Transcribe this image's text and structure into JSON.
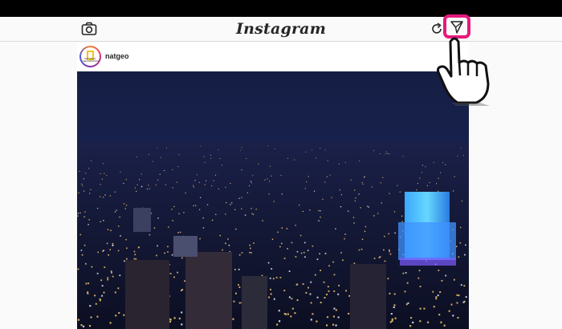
{
  "header": {
    "logo": "Instagram",
    "camera_icon": "camera-icon",
    "refresh_icon": "refresh-icon",
    "direct_icon": "paper-plane-icon"
  },
  "post": {
    "username": "natgeo",
    "avatar_text": "NATIONAL GEOGRAPHIC",
    "image_description_icon": "city-night-photo"
  },
  "highlight": {
    "color": "#e6197d",
    "pointer_icon": "pointing-hand-icon"
  }
}
